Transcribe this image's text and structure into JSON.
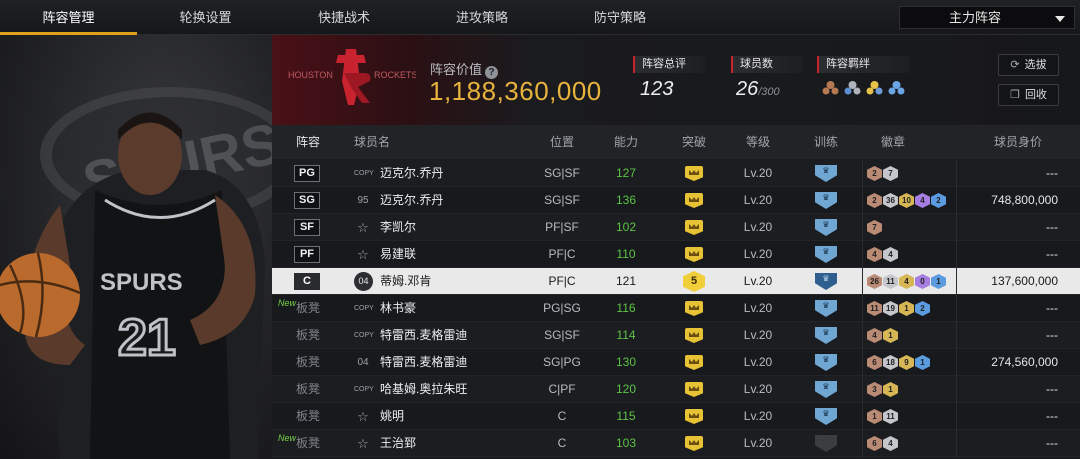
{
  "nav": {
    "tabs": [
      {
        "label": "阵容管理",
        "active": true
      },
      {
        "label": "轮换设置",
        "active": false
      },
      {
        "label": "快捷战术",
        "active": false
      },
      {
        "label": "进攻策略",
        "active": false
      },
      {
        "label": "防守策略",
        "active": false
      }
    ],
    "lineup_select": "主力阵容"
  },
  "header": {
    "team_logo_text": "HOUSTON ROCKETS",
    "value_label": "阵容价值",
    "value": "1,188,360,000",
    "overall_label": "阵容总评",
    "overall": "123",
    "players_label": "球员数",
    "players": "26",
    "players_max": "/300",
    "bonds_label": "阵容羁绊",
    "bond_icons": [
      "bond-icon-bronze",
      "bond-icon-silver",
      "bond-icon-gold",
      "bond-icon-blue"
    ],
    "btn_scout": "选拔",
    "btn_recycle": "回收"
  },
  "player_art": {
    "jersey_team": "SPURS",
    "jersey_number": "21"
  },
  "table": {
    "headers": [
      "阵容",
      "球员名",
      "位置",
      "能力",
      "突破",
      "等级",
      "训练",
      "徽章",
      "球员身价"
    ],
    "rows": [
      {
        "slot": "PG",
        "card": "COPY",
        "name": "迈克尔.乔丹",
        "pos": "SG|SF",
        "ability": "127",
        "level": "Lv.20",
        "badges": [
          [
            "bronze",
            "2"
          ],
          [
            "silver",
            "7"
          ]
        ],
        "price": "---"
      },
      {
        "slot": "SG",
        "card": "95",
        "name": "迈克尔.乔丹",
        "pos": "SG|SF",
        "ability": "136",
        "level": "Lv.20",
        "badges": [
          [
            "bronze",
            "2"
          ],
          [
            "silver",
            "36"
          ],
          [
            "gold",
            "10"
          ],
          [
            "purple",
            "4"
          ],
          [
            "blue",
            "2"
          ]
        ],
        "price": "748,800,000"
      },
      {
        "slot": "SF",
        "card": "☆",
        "name": "李凯尔",
        "pos": "PF|SF",
        "ability": "102",
        "level": "Lv.20",
        "badges": [
          [
            "bronze",
            "7"
          ]
        ],
        "price": "---"
      },
      {
        "slot": "PF",
        "card": "☆",
        "name": "易建联",
        "pos": "PF|C",
        "ability": "110",
        "level": "Lv.20",
        "badges": [
          [
            "bronze",
            "4"
          ],
          [
            "silver",
            "4"
          ]
        ],
        "price": "---"
      },
      {
        "slot": "C",
        "card": "04",
        "name": "蒂姆.邓肯",
        "pos": "PF|C",
        "ability": "121",
        "level": "Lv.20",
        "breakthrough": "5",
        "badges": [
          [
            "bronze",
            "26"
          ],
          [
            "silver",
            "11"
          ],
          [
            "gold",
            "4"
          ],
          [
            "purple",
            "0"
          ],
          [
            "blue",
            "1"
          ]
        ],
        "price": "137,600,000",
        "selected": true
      },
      {
        "slot": "板凳",
        "new": "New",
        "card": "COPY",
        "name": "林书豪",
        "pos": "PG|SG",
        "ability": "116",
        "level": "Lv.20",
        "badges": [
          [
            "bronze",
            "11"
          ],
          [
            "silver",
            "19"
          ],
          [
            "gold",
            "1"
          ],
          [
            "blue",
            "2"
          ]
        ],
        "price": "---"
      },
      {
        "slot": "板凳",
        "card": "COPY",
        "name": "特雷西.麦格雷迪",
        "pos": "SG|SF",
        "ability": "114",
        "level": "Lv.20",
        "badges": [
          [
            "bronze",
            "4"
          ],
          [
            "gold",
            "1"
          ]
        ],
        "price": "---"
      },
      {
        "slot": "板凳",
        "card": "04",
        "name": "特雷西.麦格雷迪",
        "pos": "SG|PG",
        "ability": "130",
        "level": "Lv.20",
        "badges": [
          [
            "bronze",
            "6"
          ],
          [
            "silver",
            "18"
          ],
          [
            "gold",
            "9"
          ],
          [
            "blue",
            "1"
          ]
        ],
        "price": "274,560,000"
      },
      {
        "slot": "板凳",
        "card": "COPY",
        "name": "哈基姆.奥拉朱旺",
        "pos": "C|PF",
        "ability": "120",
        "level": "Lv.20",
        "badges": [
          [
            "bronze",
            "3"
          ],
          [
            "gold",
            "1"
          ]
        ],
        "price": "---"
      },
      {
        "slot": "板凳",
        "card": "☆",
        "name": "姚明",
        "pos": "C",
        "ability": "115",
        "level": "Lv.20",
        "badges": [
          [
            "bronze",
            "1"
          ],
          [
            "silver",
            "11"
          ]
        ],
        "price": "---"
      },
      {
        "slot": "板凳",
        "new": "New",
        "card": "☆",
        "name": "王治郅",
        "pos": "C",
        "ability": "103",
        "level": "Lv.20",
        "badges": [
          [
            "bronze",
            "6"
          ],
          [
            "silver",
            "4"
          ]
        ],
        "price": "---",
        "untrained": true
      }
    ]
  },
  "colors": {
    "accent": "#e0a21a",
    "value_gold": "#e7b33c",
    "ability_green": "#5cc445",
    "new_green": "#77d34a"
  }
}
